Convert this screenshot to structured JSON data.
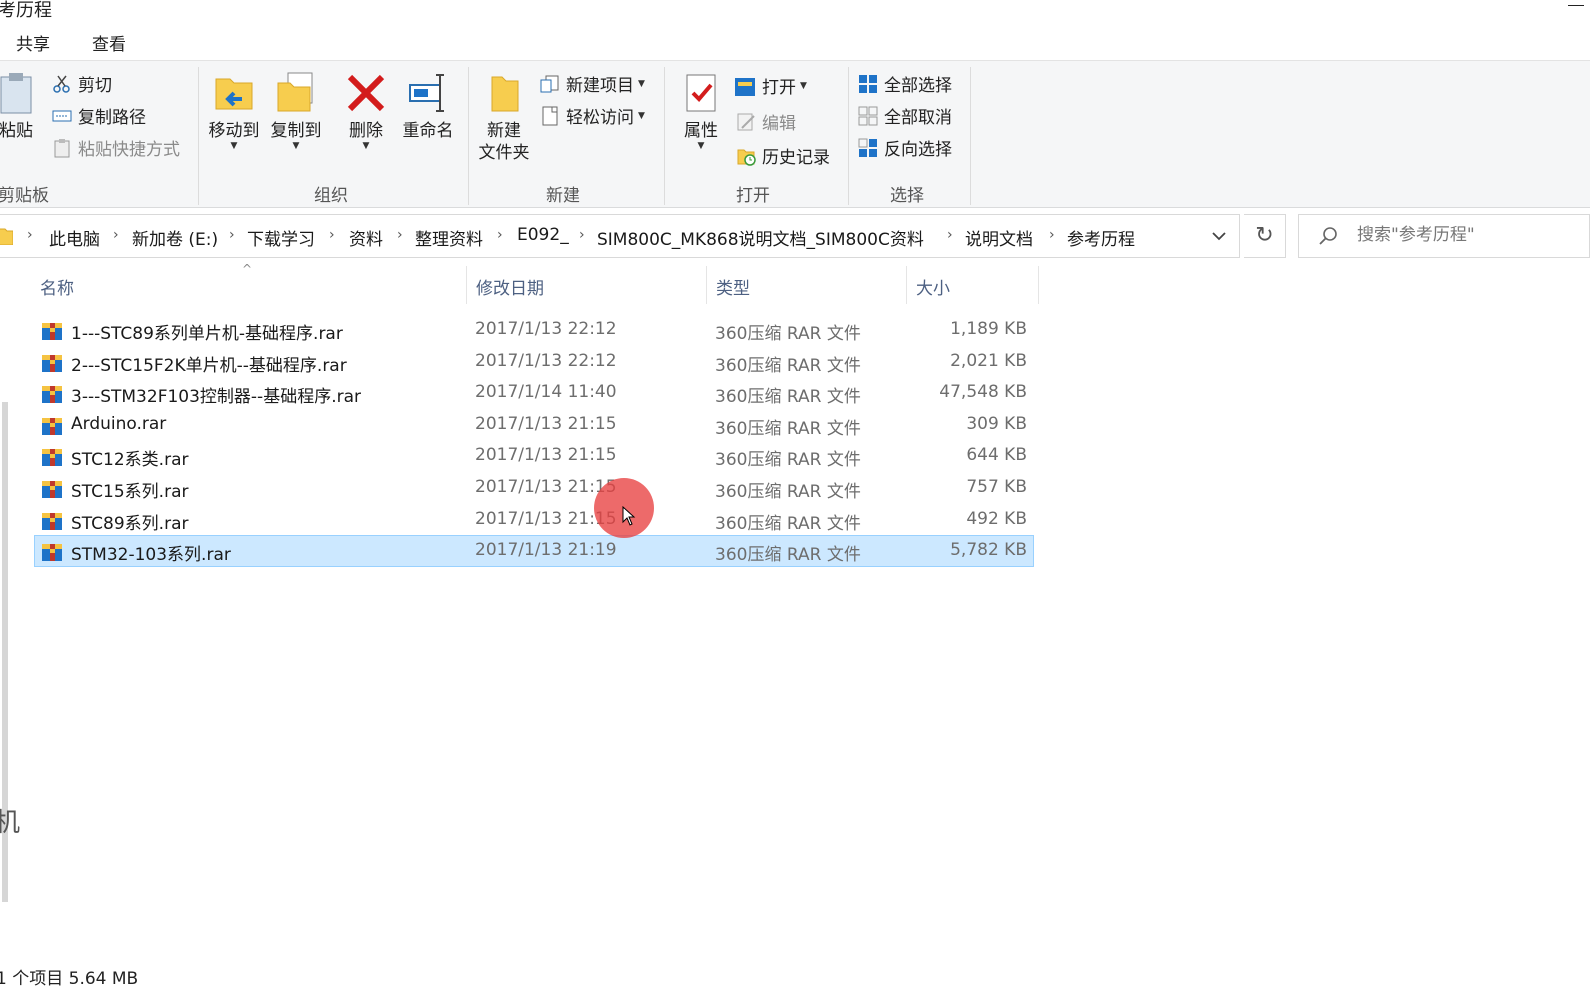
{
  "window": {
    "title": "考历程"
  },
  "ribbon_tabs": [
    {
      "label": "共享"
    },
    {
      "label": "查看"
    }
  ],
  "ribbon": {
    "clipboard": {
      "group_label": "剪贴板",
      "paste_label": "粘贴",
      "cut_label": "剪切",
      "copy_path_label": "复制路径",
      "paste_shortcut_label": "粘贴快捷方式"
    },
    "organize": {
      "group_label": "组织",
      "move_to_label": "移动到",
      "copy_to_label": "复制到",
      "delete_label": "删除",
      "rename_label": "重命名"
    },
    "new": {
      "group_label": "新建",
      "new_folder_line1": "新建",
      "new_folder_line2": "文件夹",
      "new_item_label": "新建项目",
      "easy_access_label": "轻松访问"
    },
    "open": {
      "group_label": "打开",
      "properties_label": "属性",
      "open_label": "打开",
      "edit_label": "编辑",
      "history_label": "历史记录"
    },
    "select": {
      "group_label": "选择",
      "select_all_label": "全部选择",
      "select_none_label": "全部取消",
      "invert_selection_label": "反向选择"
    }
  },
  "breadcrumb": [
    "此电脑",
    "新加卷 (E:)",
    "下载学习",
    "资料",
    "整理资料",
    "E092_",
    "SIM800C_MK868说明文档_SIM800C资料",
    "说明文档",
    "参考历程"
  ],
  "search": {
    "placeholder": "搜索\"参考历程\""
  },
  "columns": {
    "name": "名称",
    "date": "修改日期",
    "type": "类型",
    "size": "大小"
  },
  "files": [
    {
      "name": "1---STC89系列单片机-基础程序.rar",
      "date": "2017/1/13 22:12",
      "type": "360压缩 RAR 文件",
      "size": "1,189 KB",
      "selected": false
    },
    {
      "name": "2---STC15F2K单片机--基础程序.rar",
      "date": "2017/1/13 22:12",
      "type": "360压缩 RAR 文件",
      "size": "2,021 KB",
      "selected": false
    },
    {
      "name": "3---STM32F103控制器--基础程序.rar",
      "date": "2017/1/14 11:40",
      "type": "360压缩 RAR 文件",
      "size": "47,548 KB",
      "selected": false
    },
    {
      "name": "Arduino.rar",
      "date": "2017/1/13 21:15",
      "type": "360压缩 RAR 文件",
      "size": "309 KB",
      "selected": false
    },
    {
      "name": "STC12系类.rar",
      "date": "2017/1/13 21:15",
      "type": "360压缩 RAR 文件",
      "size": "644 KB",
      "selected": false
    },
    {
      "name": "STC15系列.rar",
      "date": "2017/1/13 21:15",
      "type": "360压缩 RAR 文件",
      "size": "757 KB",
      "selected": false
    },
    {
      "name": "STC89系列.rar",
      "date": "2017/1/13 21:15",
      "type": "360压缩 RAR 文件",
      "size": "492 KB",
      "selected": false
    },
    {
      "name": "STM32-103系列.rar",
      "date": "2017/1/13 21:19",
      "type": "360压缩 RAR 文件",
      "size": "5,782 KB",
      "selected": true
    }
  ],
  "left_nav_fragment": "机",
  "status": {
    "text": "1 个项目 5.64 MB"
  },
  "colors": {
    "selection_bg": "#cce8ff",
    "selection_border": "#99d1ff",
    "ribbon_bg": "#f5f6f7",
    "delete_red": "#d31c1c",
    "folder_yellow": "#f5c342",
    "cursor_highlight": "#e84040"
  }
}
